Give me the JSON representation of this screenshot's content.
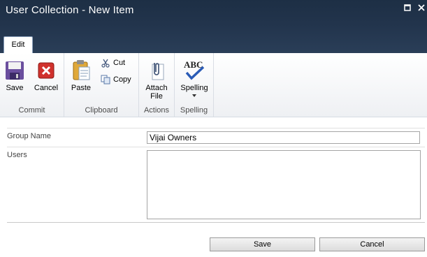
{
  "window": {
    "title": "User Collection - New Item"
  },
  "ribbon": {
    "tab": "Edit",
    "groups": {
      "commit": {
        "label": "Commit",
        "save": "Save",
        "cancel": "Cancel"
      },
      "clipboard": {
        "label": "Clipboard",
        "paste": "Paste",
        "cut": "Cut",
        "copy": "Copy"
      },
      "actions": {
        "label": "Actions",
        "attach_line1": "Attach",
        "attach_line2": "File"
      },
      "spelling": {
        "label": "Spelling",
        "spelling": "Spelling",
        "icon_text": "ABC"
      }
    }
  },
  "form": {
    "group_name": {
      "label": "Group Name",
      "value": "Vijai Owners"
    },
    "users": {
      "label": "Users",
      "value": ""
    }
  },
  "buttons": {
    "save": "Save",
    "cancel": "Cancel"
  },
  "colors": {
    "titlebar": "#22344c",
    "ribbon_bg": "#f5f6f8"
  }
}
